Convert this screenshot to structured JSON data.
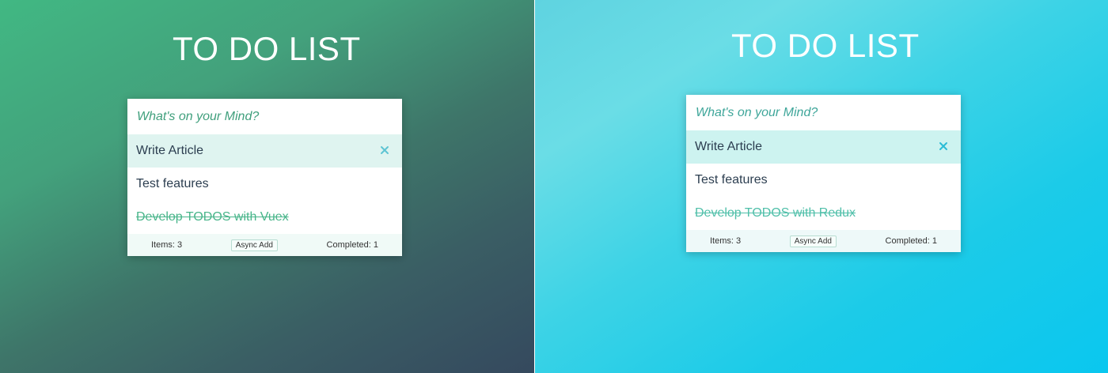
{
  "panels": [
    {
      "title": "TO DO LIST",
      "input_placeholder": "What's on your Mind?",
      "todos": [
        {
          "text": "Write Article",
          "completed": false,
          "hovered": true
        },
        {
          "text": "Test features",
          "completed": false,
          "hovered": false
        },
        {
          "text": "Develop TODOS with Vuex",
          "completed": true,
          "hovered": false
        }
      ],
      "footer": {
        "items": "Items: 3",
        "async_button": "Async Add",
        "completed": "Completed: 1"
      },
      "colors": {
        "gradient_start": "#41b883",
        "gradient_end": "#35495e",
        "accent": "#41b883"
      }
    },
    {
      "title": "TO DO LIST",
      "input_placeholder": "What's on your Mind?",
      "todos": [
        {
          "text": "Write Article",
          "completed": false,
          "hovered": true
        },
        {
          "text": "Test features",
          "completed": false,
          "hovered": false
        },
        {
          "text": "Develop TODOS with Redux",
          "completed": true,
          "hovered": false
        }
      ],
      "footer": {
        "items": "Items: 3",
        "async_button": "Async Add",
        "completed": "Completed: 1"
      },
      "colors": {
        "gradient_start": "#6adde6",
        "gradient_end": "#0ac7ef",
        "accent": "#2ec4d6"
      }
    }
  ],
  "icons": {
    "delete": "close-icon"
  }
}
